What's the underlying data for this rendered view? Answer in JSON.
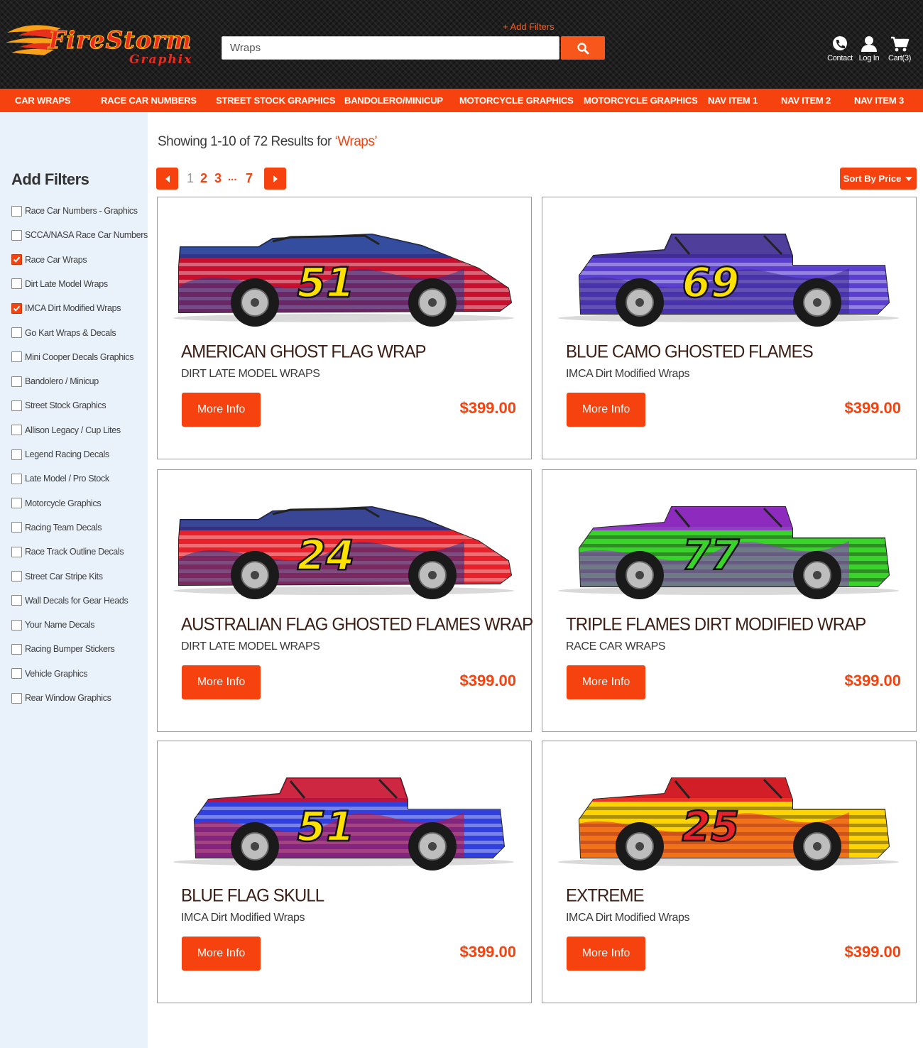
{
  "header": {
    "logo": {
      "line1": "FireStorm",
      "line2": "Graphix"
    },
    "add_filters_link": "+ Add Filters",
    "search": {
      "value": "Wraps",
      "placeholder": "Search"
    },
    "links": [
      {
        "label": "Contact",
        "icon": "phone-icon"
      },
      {
        "label": "Log In",
        "icon": "user-icon"
      },
      {
        "label": "Cart(3)",
        "icon": "cart-icon"
      }
    ]
  },
  "nav": [
    "CAR WRAPS",
    "RACE CAR NUMBERS",
    "STREET STOCK GRAPHICS",
    "BANDOLERO/MINICUP",
    "MOTORCYCLE GRAPHICS",
    "MOTORCYCLE GRAPHICS",
    "NAV ITEM 1",
    "NAV ITEM 2",
    "NAV ITEM 3"
  ],
  "sidebar": {
    "title": "Add Filters",
    "filters": [
      {
        "label": "Race Car Numbers - Graphics",
        "checked": false
      },
      {
        "label": "SCCA/NASA Race Car Numbers",
        "checked": false
      },
      {
        "label": "Race Car Wraps",
        "checked": true
      },
      {
        "label": "Dirt Late Model Wraps",
        "checked": false
      },
      {
        "label": "IMCA Dirt Modified Wraps",
        "checked": true
      },
      {
        "label": "Go Kart Wraps & Decals",
        "checked": false
      },
      {
        "label": "Mini Cooper Decals Graphics",
        "checked": false
      },
      {
        "label": "Bandolero / Minicup",
        "checked": false
      },
      {
        "label": "Street Stock Graphics",
        "checked": false
      },
      {
        "label": "Allison Legacy / Cup Lites",
        "checked": false
      },
      {
        "label": "Legend Racing Decals",
        "checked": false
      },
      {
        "label": "Late Model / Pro Stock",
        "checked": false
      },
      {
        "label": "Motorcycle Graphics",
        "checked": false
      },
      {
        "label": "Racing Team Decals",
        "checked": false
      },
      {
        "label": "Race Track Outline Decals",
        "checked": false
      },
      {
        "label": "Street Car Stripe Kits",
        "checked": false
      },
      {
        "label": "Wall Decals for Gear Heads",
        "checked": false
      },
      {
        "label": "Your Name Decals",
        "checked": false
      },
      {
        "label": "Racing Bumper Stickers",
        "checked": false
      },
      {
        "label": "Vehicle Graphics",
        "checked": false
      },
      {
        "label": "Rear Window Graphics",
        "checked": false
      }
    ]
  },
  "results": {
    "prefix": "Showing 1-10 of 72 Results for ",
    "query": "‘Wraps’"
  },
  "pagination": {
    "pages": [
      "1",
      "2",
      "3",
      "...",
      "7"
    ],
    "current": "1"
  },
  "sort": {
    "label": "Sort By Price"
  },
  "products": [
    {
      "title": "AMERICAN GHOST FLAG WRAP",
      "category": "DIRT LATE MODEL WRAPS",
      "price": "$399.00",
      "button": "More Info",
      "car_number": "51",
      "style": "late",
      "colors": [
        "#c8102e",
        "#1f3a93",
        "#ffffff",
        "#ffe100"
      ]
    },
    {
      "title": "BLUE CAMO GHOSTED FLAMES",
      "category": "IMCA Dirt Modified Wraps",
      "price": "$399.00",
      "button": "More Info",
      "car_number": "69",
      "style": "modified",
      "colors": [
        "#5a3fd1",
        "#3d2a8f",
        "#ffffff",
        "#ffe100"
      ]
    },
    {
      "title": "AUSTRALIAN FLAG GHOSTED FLAMES WRAP",
      "category": "DIRT LATE MODEL WRAPS",
      "price": "$399.00",
      "button": "More Info",
      "car_number": "24",
      "style": "late",
      "colors": [
        "#e8202a",
        "#22328a",
        "#ffffff",
        "#ffe100"
      ]
    },
    {
      "title": "TRIPLE FLAMES DIRT MODIFIED WRAP",
      "category": "RACE CAR WRAPS",
      "price": "$399.00",
      "button": "More Info",
      "car_number": "77",
      "style": "modified",
      "colors": [
        "#39d42a",
        "#9b2fd1",
        "#111111",
        "#39d42a"
      ]
    },
    {
      "title": "BLUE FLAG SKULL",
      "category": "IMCA Dirt Modified Wraps",
      "price": "$399.00",
      "button": "More Info",
      "car_number": "51",
      "style": "modified",
      "colors": [
        "#2f3fe0",
        "#c8102e",
        "#ffffff",
        "#ffe100"
      ]
    },
    {
      "title": "EXTREME",
      "category": "IMCA Dirt Modified Wraps",
      "price": "$399.00",
      "button": "More Info",
      "car_number": "25",
      "style": "modified",
      "colors": [
        "#ffd400",
        "#e8202a",
        "#111111",
        "#e8202a"
      ]
    }
  ],
  "colors": {
    "accent": "#f5420f",
    "sidebar_bg": "#e9f1fb",
    "header_bg": "#1e1e1e",
    "title_text": "#3b1f14"
  }
}
